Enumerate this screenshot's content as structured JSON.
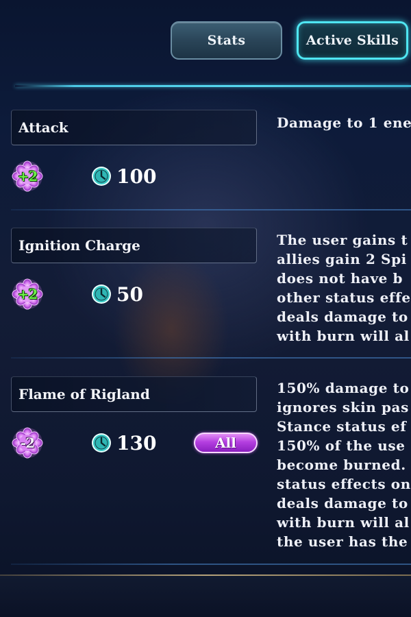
{
  "tabs": {
    "stats_label": "Stats",
    "active_skills_label": "Active Skills",
    "selected": "Active Skills"
  },
  "skills": [
    {
      "name": "Attack",
      "spirit_cost": "+2",
      "cooldown": "100",
      "target": "",
      "description_lines": [
        "Damage to 1 ene"
      ]
    },
    {
      "name": "Ignition Charge",
      "spirit_cost": "+2",
      "cooldown": "50",
      "target": "",
      "description_lines": [
        "The user gains t",
        "allies gain 2 Spi",
        "does not have b",
        "other status effe",
        "deals damage to",
        "with burn will al"
      ]
    },
    {
      "name": "Flame of Rigland",
      "spirit_cost": "-2",
      "cooldown": "130",
      "target": "All",
      "description_lines": [
        "150% damage to",
        "ignores skin pas",
        "Stance status ef",
        "150% of the use",
        "become burned.",
        "status effects on",
        "deals damage to",
        "with burn will al",
        "the user has the"
      ]
    }
  ],
  "colors": {
    "tab_active_border": "#4fe6f2",
    "cost_plus": "#6cf048",
    "cost_badge": "#c95be6",
    "target_badge": "#b43fe0",
    "clock": "#35c8c4"
  },
  "icons": {
    "spirit_cost": "spirit-flower-icon",
    "cooldown": "clock-icon"
  }
}
